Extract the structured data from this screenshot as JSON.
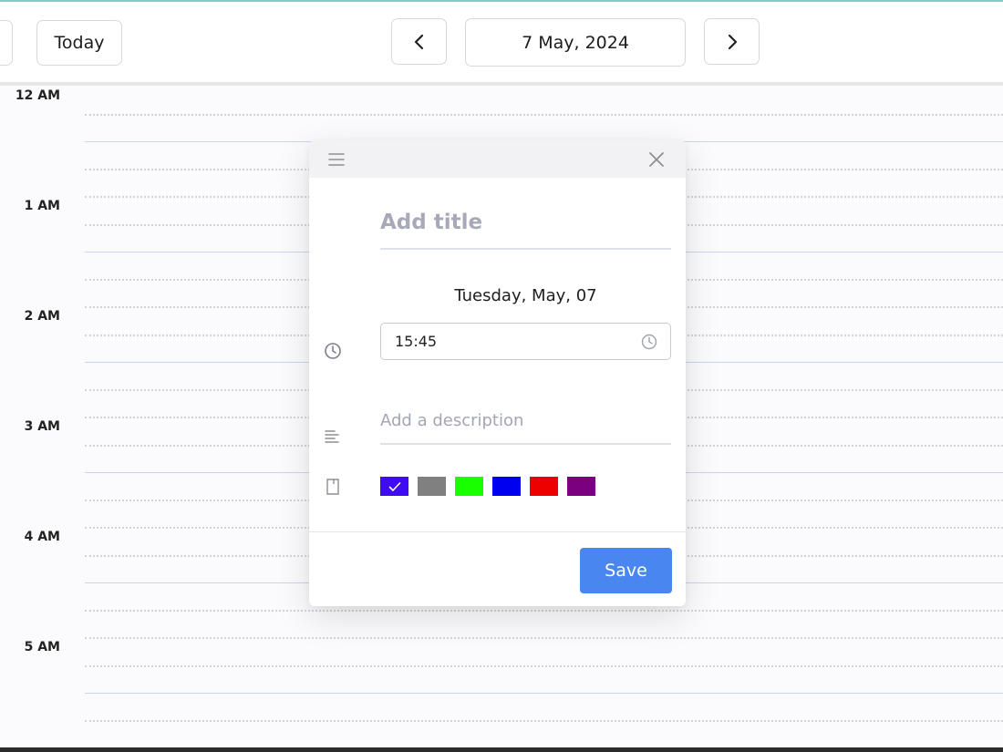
{
  "toolbar": {
    "today_label": "Today",
    "current_date": "7 May, 2024",
    "prev_icon": "chevron-left-icon",
    "next_icon": "chevron-right-icon"
  },
  "grid": {
    "hours": [
      "12 AM",
      "1 AM",
      "2 AM",
      "3 AM",
      "4 AM",
      "5 AM"
    ]
  },
  "modal": {
    "header_icon": "menu-icon",
    "close_icon": "close-icon",
    "title_placeholder": "Add title",
    "date_label": "Tuesday, May, 07",
    "time_value": "15:45",
    "description_placeholder": "Add a description",
    "colors": [
      {
        "hex": "#3f0bf2",
        "selected": true
      },
      {
        "hex": "#808080",
        "selected": false
      },
      {
        "hex": "#19ff00",
        "selected": false
      },
      {
        "hex": "#0000f0",
        "selected": false
      },
      {
        "hex": "#ee0000",
        "selected": false
      },
      {
        "hex": "#7a0080",
        "selected": false
      }
    ],
    "save_label": "Save"
  },
  "theme": {
    "accent": "#4a86f0",
    "border": "#d8d8dc"
  }
}
